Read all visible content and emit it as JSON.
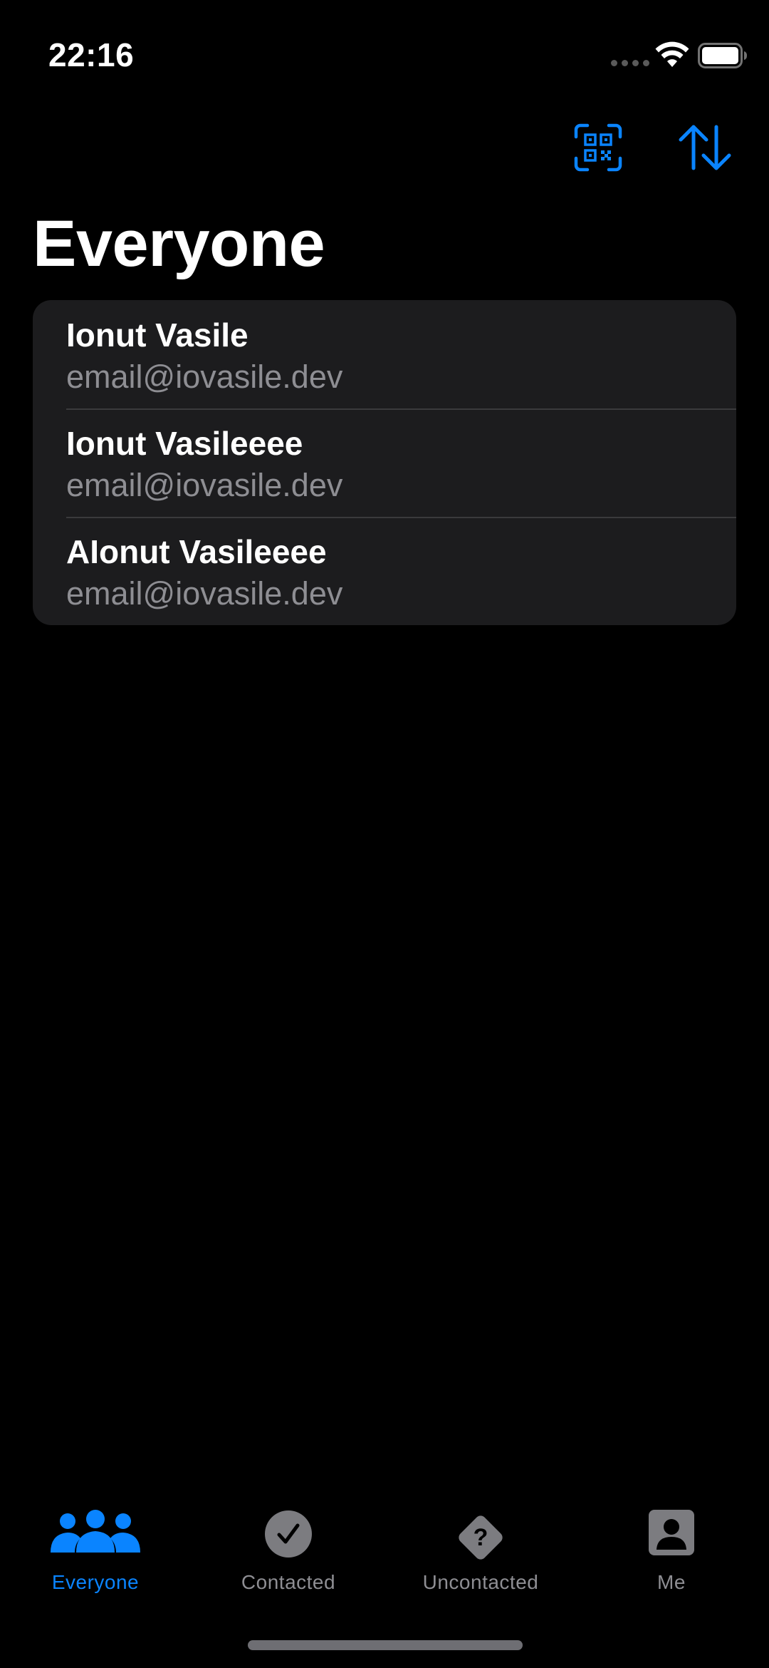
{
  "status_bar": {
    "time": "22:16",
    "icons": [
      "cellular-signal-icon",
      "wifi-icon",
      "battery-icon"
    ]
  },
  "toolbar": {
    "qr_icon": "qr-code-scan-icon",
    "sort_icon": "sort-arrows-icon"
  },
  "page": {
    "title": "Everyone"
  },
  "contacts": [
    {
      "name": "Ionut Vasile",
      "email": "email@iovasile.dev"
    },
    {
      "name": "Ionut Vasileeee",
      "email": "email@iovasile.dev"
    },
    {
      "name": "AIonut Vasileeee",
      "email": "email@iovasile.dev"
    }
  ],
  "tab_bar": {
    "tabs": [
      {
        "label": "Everyone",
        "icon": "people-icon",
        "active": true
      },
      {
        "label": "Contacted",
        "icon": "checkmark-circle-icon",
        "active": false
      },
      {
        "label": "Uncontacted",
        "icon": "question-diamond-icon",
        "active": false
      },
      {
        "label": "Me",
        "icon": "person-square-icon",
        "active": false
      }
    ]
  },
  "colors": {
    "background": "#000000",
    "accent": "#0a84ff",
    "cell_background": "#1c1c1e",
    "secondary_text": "#8e8e93",
    "separator": "#3a3a3c"
  }
}
